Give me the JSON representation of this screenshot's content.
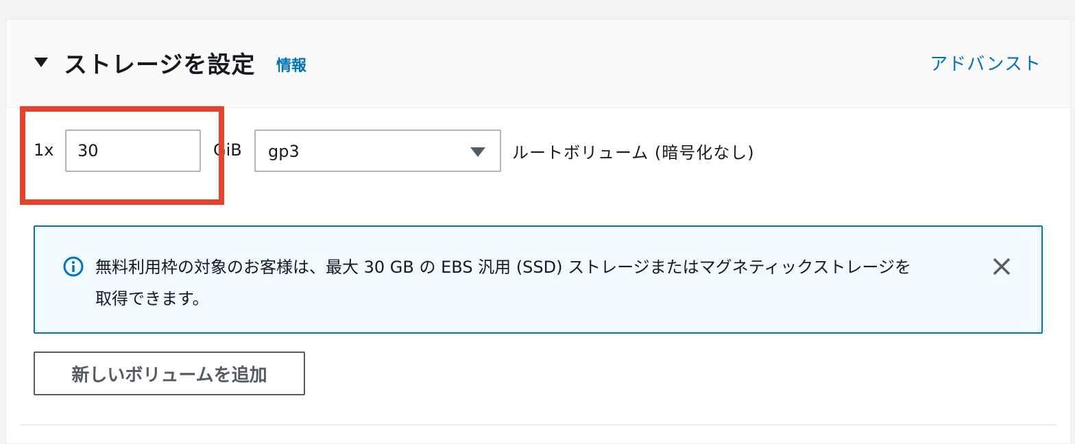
{
  "section": {
    "title": "ストレージを設定",
    "info_link": "情報",
    "advanced_link": "アドバンスト"
  },
  "volume": {
    "count_label": "1x",
    "size_value": "30",
    "unit_label": "GiB",
    "type_value": "gp3",
    "description": "ルートボリューム  (暗号化なし)"
  },
  "alert": {
    "text": "無料利用枠の対象のお客様は、最大 30 GB の EBS 汎用 (SSD) ストレージまたはマグネティックストレージを取得できます。"
  },
  "buttons": {
    "add_volume": "新しいボリュームを追加"
  },
  "icons": {
    "caret": "caret-down-icon",
    "dropdown": "dropdown-arrow-icon",
    "info": "info-circle-icon",
    "close": "close-icon"
  },
  "colors": {
    "link": "#0073bb",
    "highlight": "#e8412c",
    "alert_border": "#0073bb",
    "alert_background": "#f1faff"
  }
}
